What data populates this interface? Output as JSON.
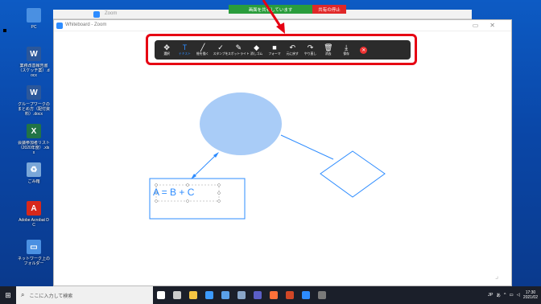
{
  "desktop_icons": [
    {
      "name": "pc",
      "label": "PC",
      "color": "#4a90e2",
      "glyph": ""
    },
    {
      "name": "word1",
      "label": "業務改善報告書（スケッチ案）.docx",
      "color": "#2b579a",
      "glyph": "W"
    },
    {
      "name": "word2",
      "label": "グループワークのまとめ方（配付資料）.docx",
      "color": "#2b579a",
      "glyph": "W"
    },
    {
      "name": "excel",
      "label": "会議参加者リスト（2020年度）.xlsx",
      "color": "#217346",
      "glyph": "X"
    },
    {
      "name": "recycle",
      "label": "ごみ箱",
      "color": "#7aa7d8",
      "glyph": "♻"
    },
    {
      "name": "acrobat",
      "label": "Adobe Acrobat DC",
      "color": "#d7281c",
      "glyph": "A"
    },
    {
      "name": "computer",
      "label": "ネットワーク上のフォルダー",
      "color": "#4a90e2",
      "glyph": "▭"
    }
  ],
  "zoom_window": {
    "title": "Zoom"
  },
  "share_bar": {
    "status": "画面を共有しています",
    "stop_label": "共有の停止"
  },
  "whiteboard_window": {
    "title": "Whiteboard - Zoom"
  },
  "toolbar": {
    "tools": [
      {
        "id": "select",
        "icon": "move-icon",
        "glyph": "✥",
        "label": "選択"
      },
      {
        "id": "text",
        "icon": "text-icon",
        "glyph": "T",
        "label": "テキスト",
        "active": true
      },
      {
        "id": "draw",
        "icon": "pen-icon",
        "glyph": "╱",
        "label": "絵を描く"
      },
      {
        "id": "stamp",
        "icon": "check-icon",
        "glyph": "✓",
        "label": "スタンプを"
      },
      {
        "id": "spotlight",
        "icon": "spotlight-icon",
        "glyph": "✎",
        "label": "スポットライト"
      },
      {
        "id": "eraser",
        "icon": "eraser-icon",
        "glyph": "◆",
        "label": "消しゴム"
      },
      {
        "id": "format",
        "icon": "format-icon",
        "glyph": "■",
        "label": "フォーマ"
      },
      {
        "id": "undo",
        "icon": "undo-icon",
        "glyph": "↶",
        "label": "元に戻す"
      },
      {
        "id": "redo",
        "icon": "redo-icon",
        "glyph": "↷",
        "label": "やり直し"
      },
      {
        "id": "clear",
        "icon": "trash-icon",
        "glyph": "🗑",
        "label": "消去"
      },
      {
        "id": "save",
        "icon": "save-icon",
        "glyph": "⤓",
        "label": "保存"
      }
    ],
    "close_glyph": "✕"
  },
  "canvas": {
    "equation": "A = B + C",
    "accent": "#2d8cff",
    "ellipse_fill": "#a9ccf7"
  },
  "taskbar": {
    "search_placeholder": "ここに入力して検索",
    "apps": [
      {
        "name": "cortana-icon",
        "color": "#fff"
      },
      {
        "name": "taskview-icon",
        "color": "#ccc"
      },
      {
        "name": "explorer-icon",
        "color": "#f5c542"
      },
      {
        "name": "edge-icon",
        "color": "#3c9bff"
      },
      {
        "name": "store-icon",
        "color": "#5aa0e8"
      },
      {
        "name": "mail-icon",
        "color": "#8aa6c8"
      },
      {
        "name": "teams-icon",
        "color": "#5b5fc7"
      },
      {
        "name": "firefox-icon",
        "color": "#ff7139"
      },
      {
        "name": "powerpoint-icon",
        "color": "#d24726"
      },
      {
        "name": "zoom-icon",
        "color": "#2d8cff"
      },
      {
        "name": "app-icon",
        "color": "#7a7a7a"
      }
    ],
    "tray": {
      "ime": "JP",
      "lang": "あ",
      "time": "17:30",
      "date": "2021/02"
    }
  }
}
